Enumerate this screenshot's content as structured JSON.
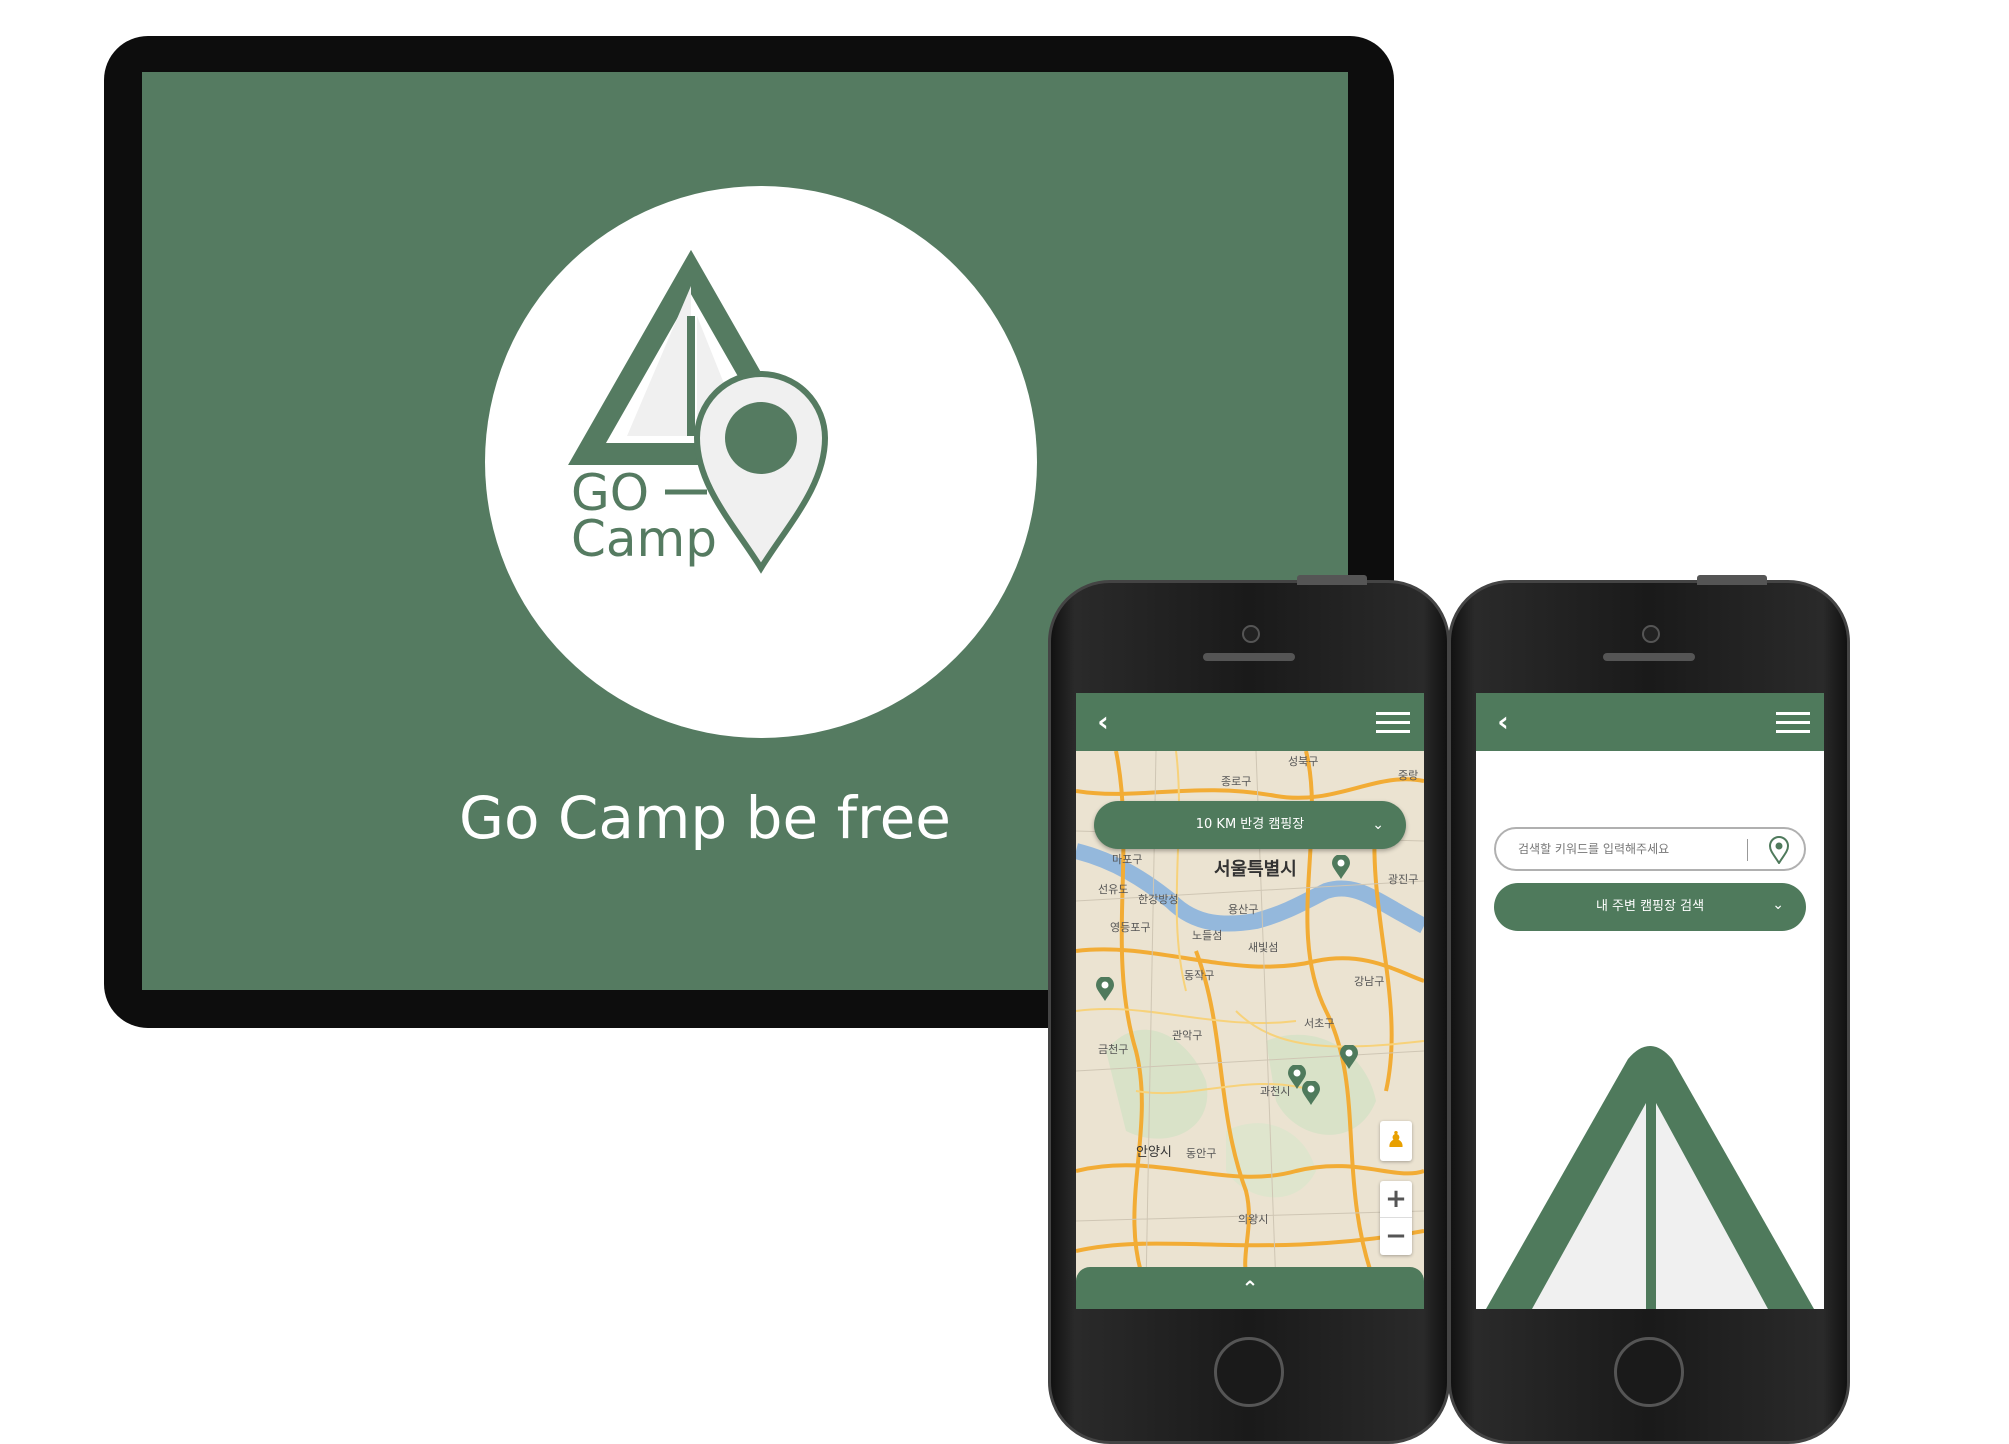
{
  "tablet": {
    "logo_text_line1": "GO",
    "logo_text_line2": "Camp",
    "tagline": "Go Camp be free"
  },
  "phone_map": {
    "back_icon": "chevron-left-icon",
    "menu_icon": "hamburger-icon",
    "dropdown_label": "10 KM 반경 캠핑장",
    "dropdown_icon": "chevron-down-icon",
    "map_labels": {
      "seoul": "서울특별시",
      "seongbuk": "성북구",
      "jongno": "종로구",
      "jung": "중랑",
      "mapo": "마포구",
      "seonyudo": "선유도",
      "hangang": "한강방성",
      "gwangjin": "광진구",
      "yongsan": "용산구",
      "yeongdeungpo": "영등포구",
      "nodeulseom": "노들섬",
      "seobinggo": "새빛섬",
      "dongjak": "동작구",
      "gangnam": "강남구",
      "gwanak": "관악구",
      "seocho": "서초구",
      "geumcheon": "금천구",
      "gwacheon": "과천시",
      "anyang": "안양시",
      "dongan": "동안구",
      "uiwang": "의왕시"
    },
    "pegman_icon": "pegman-icon",
    "zoom_in": "+",
    "zoom_out": "−",
    "expand_label": "⌃"
  },
  "phone_search": {
    "back_icon": "chevron-left-icon",
    "menu_icon": "hamburger-icon",
    "search_placeholder": "검색할 키워드를 입력해주세요",
    "location_icon": "map-pin-icon",
    "nearby_button": "내 주변 캠핑장 검색",
    "nearby_icon": "chevron-down-icon"
  },
  "colors": {
    "brand_green": "#557b61",
    "appbar_green": "#4f7a5c",
    "device_black": "#0d0d0d"
  }
}
